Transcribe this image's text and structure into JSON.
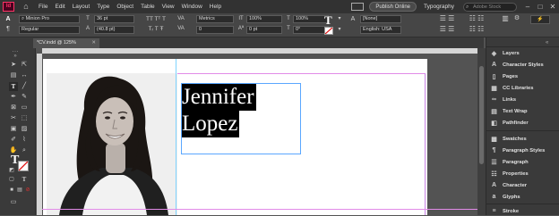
{
  "menubar": {
    "app_badge": "Id",
    "items": [
      "File",
      "Edit",
      "Layout",
      "Type",
      "Object",
      "Table",
      "View",
      "Window",
      "Help"
    ],
    "publish_label": "Publish Online",
    "workspace_label": "Typography",
    "search_placeholder": "Adobe Stock",
    "window_controls": [
      "–",
      "□",
      "✕"
    ]
  },
  "control": {
    "font_family": "Minion Pro",
    "font_style": "Regular",
    "font_size": "36 pt",
    "leading": "(40.8 pt)",
    "kerning": "Metrics",
    "tracking": "0",
    "vertical_scale": "100%",
    "horizontal_scale": "100%",
    "baseline_shift": "0 pt",
    "skew": "0°",
    "char_style": "[None]",
    "language": "English: USA"
  },
  "tab": {
    "title": "*CV.indd @ 125%",
    "close": "✕"
  },
  "document": {
    "text_line_1": "Jennifer",
    "text_line_2": "Lopez"
  },
  "panels": {
    "group1": [
      "Layers",
      "Character Styles",
      "Pages",
      "CC Libraries",
      "Links",
      "Text Wrap",
      "Pathfinder"
    ],
    "group2": [
      "Swatches",
      "Paragraph Styles",
      "Paragraph",
      "Properties",
      "Character",
      "Glyphs"
    ],
    "group3": [
      "Stroke"
    ]
  },
  "colors": {
    "accent": "#ff3366",
    "frame_selection": "#5aa7ff",
    "margin_guide": "#e28be8"
  }
}
